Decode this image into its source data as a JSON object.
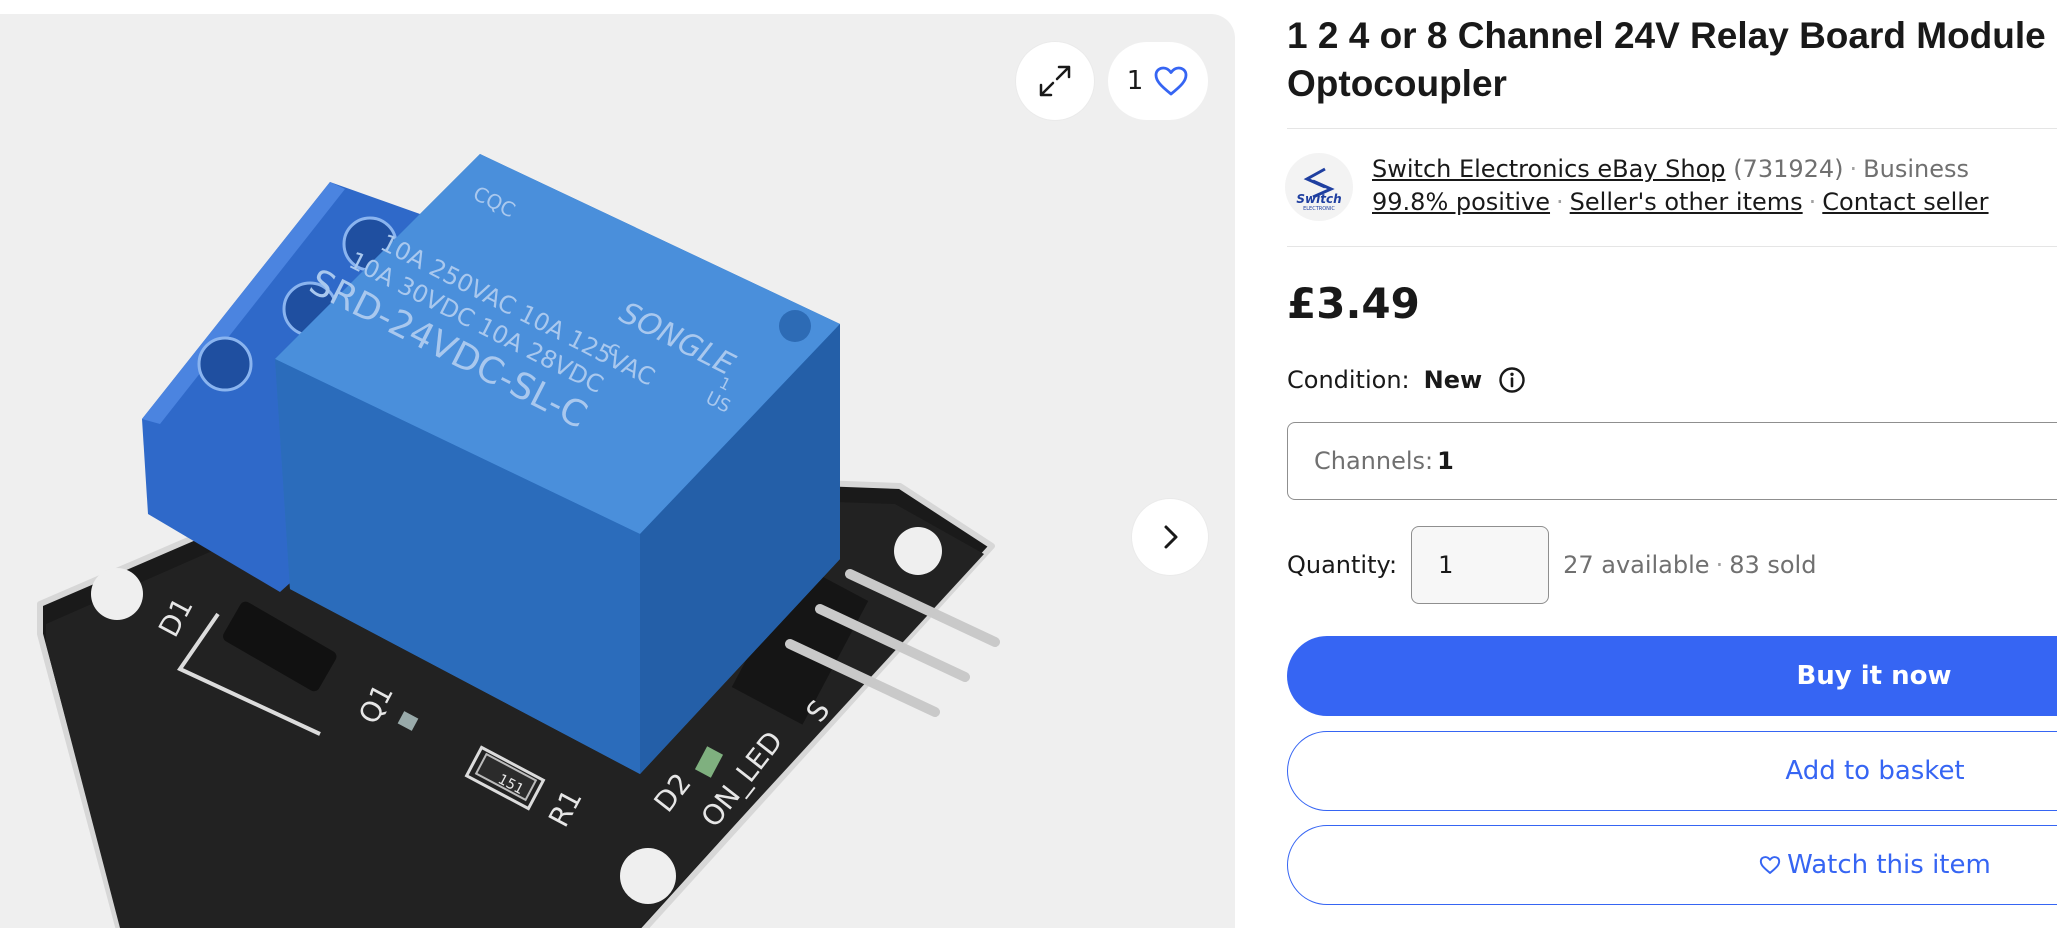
{
  "gallery": {
    "expand_icon": "expand-icon",
    "watch_count": "1",
    "heart_icon": "heart-outline-icon",
    "next_icon": "chevron-right-icon",
    "product_image": "relay-module-photo",
    "relay_print": {
      "brand": "SONGLE",
      "cqc": "CQC",
      "line1": "10A 250VAC  10A 125VAC",
      "line2": "10A 30VDC  10A 28VDC",
      "model": "SRD-24VDC-SL-C",
      "ul_c": "c",
      "ul_us": "US",
      "ul_1": "1"
    },
    "pcb_labels": {
      "d1": "D1",
      "q1": "Q1",
      "r1": "R1",
      "resistor": "151",
      "d2": "D2",
      "on_led": "ON_LED",
      "s": "S"
    }
  },
  "listing": {
    "title": "1 2 4 or 8 Channel 24V Relay Board Module Optocoupler",
    "seller": {
      "name": "Switch Electronics eBay Shop",
      "feedback_count": "(731924)",
      "type": "Business",
      "positive": "99.8% positive",
      "other_items": "Seller's other items",
      "contact": "Contact seller",
      "logo_text_top": "Switch",
      "logo_text_bottom": "ELECTRONIC"
    },
    "price": "£3.49",
    "condition_label": "Condition:",
    "condition_value": "New",
    "variation": {
      "label": "Channels:",
      "value": "1"
    },
    "quantity_label": "Quantity:",
    "quantity_value": "1",
    "available": "27 available",
    "sold": "83 sold",
    "buy_label": "Buy it now",
    "basket_label": "Add to basket",
    "watch_label": "Watch this item"
  },
  "colors": {
    "accent": "#3665f3",
    "text": "#191919",
    "muted": "#707070",
    "gallery_bg": "#efefef"
  }
}
